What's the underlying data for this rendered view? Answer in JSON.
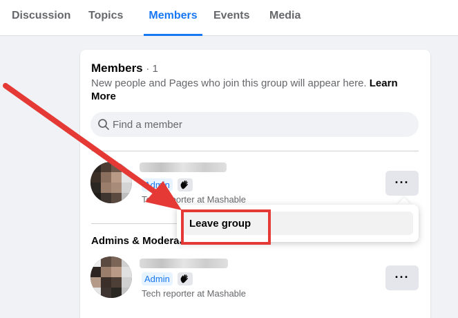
{
  "tabs": [
    {
      "label": "Discussion",
      "active": false
    },
    {
      "label": "Topics",
      "active": false
    },
    {
      "label": "Members",
      "active": true
    },
    {
      "label": "Events",
      "active": false
    },
    {
      "label": "Media",
      "active": false
    }
  ],
  "members_card": {
    "title": "Members",
    "count": "· 1",
    "description": "New people and Pages who join this group will appear here.",
    "learn_more": "Learn More",
    "search": {
      "placeholder": "Find a member",
      "value": ""
    }
  },
  "member_row": {
    "badge": "Admin",
    "subtitle": "Tech reporter at Mashable",
    "more_label": "···"
  },
  "context_menu": {
    "items": [
      {
        "label": "Leave group"
      }
    ]
  },
  "admins_section": {
    "title": "Admins & Moderators"
  },
  "admin_row": {
    "badge": "Admin",
    "subtitle": "Tech reporter at Mashable",
    "more_label": "···"
  },
  "colors": {
    "accent": "#1877f2",
    "annotation": "#e53935",
    "background": "#f0f2f5"
  },
  "icons": {
    "search": "search-icon",
    "wave": "hand-wave-icon",
    "more": "more-horizontal-icon"
  }
}
